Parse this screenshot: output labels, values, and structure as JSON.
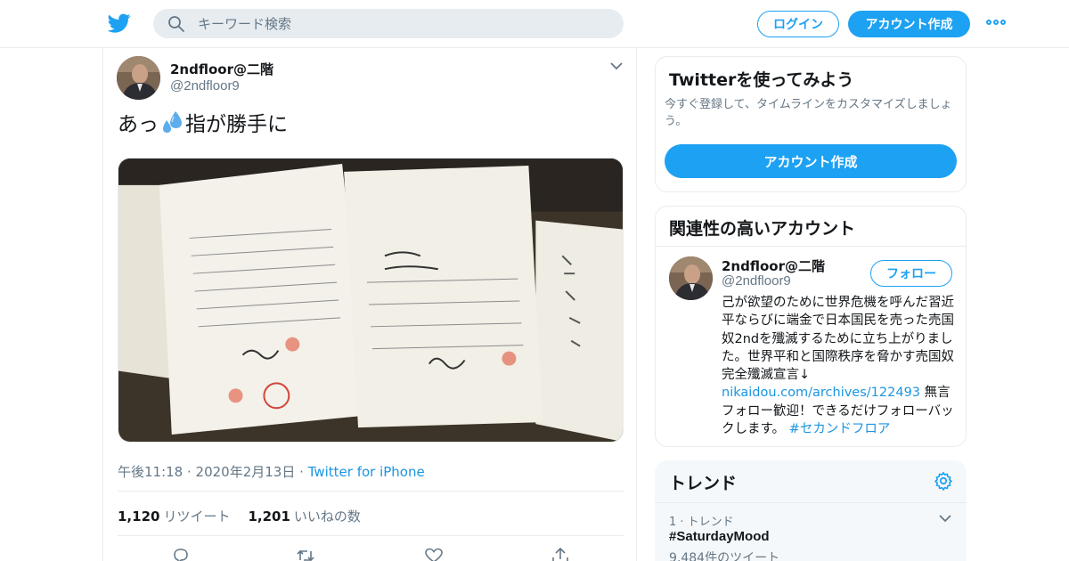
{
  "header": {
    "search_placeholder": "キーワード検索",
    "login_label": "ログイン",
    "signup_label": "アカウント作成"
  },
  "tweet": {
    "author_name": "2ndfloor@二階",
    "author_handle": "@2ndfloor9",
    "text_before_emoji": "あっ",
    "emoji": "sweat-droplets-icon",
    "text_after_emoji": "指が勝手に",
    "time": "午後11:18 · 2020年2月13日 · ",
    "source": "Twitter for iPhone",
    "retweets_count": "1,120",
    "retweets_label": "リツイート",
    "likes_count": "1,201",
    "likes_label": "いいねの数"
  },
  "try_card": {
    "title": "Twitterを使ってみよう",
    "subtitle": "今すぐ登録して、タイムラインをカスタマイズしましょう。",
    "button_label": "アカウント作成"
  },
  "related": {
    "title": "関連性の高いアカウント",
    "name": "2ndfloor@二階",
    "handle": "@2ndfloor9",
    "follow_label": "フォロー",
    "bio_text": "己が欲望のために世界危機を呼んだ習近平ならびに端金で日本国民を売った売国奴2ndを殲滅するために立ち上がりました。世界平和と国際秩序を脅かす売国奴完全殲滅宣言↓",
    "bio_link": "nikaidou.com/archives/122493",
    "bio_text2": " 無言フォロー歓迎！できるだけフォローバックします。",
    "bio_hashtag": "#セカンドフロア"
  },
  "trends": {
    "title": "トレンド",
    "items": [
      {
        "rank_label": "1 · トレンド",
        "name": "#SaturdayMood",
        "count": "9,484件のツイート"
      }
    ]
  },
  "colors": {
    "accent": "#1da1f2",
    "link": "#1b95e0",
    "text": "#14171a",
    "secondary": "#657786",
    "border": "#e6ecf0"
  }
}
